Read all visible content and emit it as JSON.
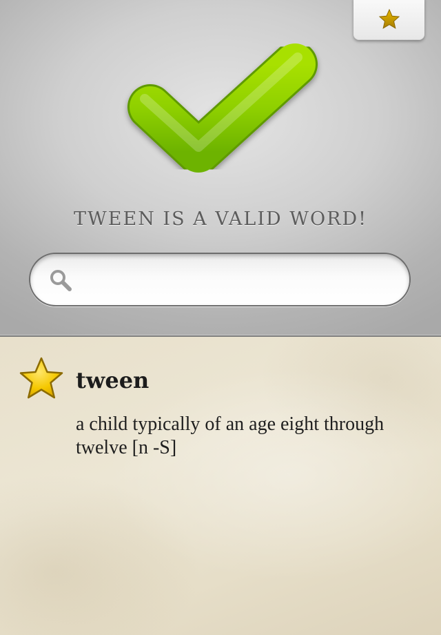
{
  "header": {
    "favorites_icon": "star-icon",
    "result_icon": "checkmark-icon",
    "result_message": "tween is a valid word!"
  },
  "search": {
    "icon": "search-icon",
    "value": "",
    "placeholder": ""
  },
  "definition": {
    "favorite_icon": "star-icon",
    "word": "tween",
    "text": "a child typically of an age eight through twelve [n -S]"
  },
  "colors": {
    "check_green": "#8fd000",
    "star_gold": "#f2c200",
    "star_small": "#c99b00",
    "metal_light": "#e4e4e4",
    "metal_dark": "#a9a9a9",
    "parchment": "#e9e2cf"
  }
}
